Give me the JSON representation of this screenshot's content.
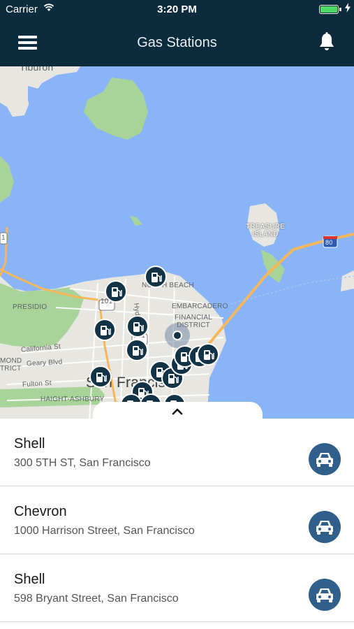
{
  "status_bar": {
    "carrier": "Carrier",
    "time": "3:20 PM",
    "battery_percent": 100,
    "icons": [
      "wifi-icon",
      "battery-icon",
      "charging-icon"
    ]
  },
  "header": {
    "title": "Gas Stations",
    "left_icon": "menu-icon",
    "right_icon": "bell-icon",
    "background_color": "#0c2b3d"
  },
  "map": {
    "labels": {
      "tiburon": "Tiburon",
      "treasure_island": "TREASURE\nISLAND",
      "north_beach": "NORTH BEACH",
      "embarcadero": "EMBARCADERO",
      "financial_district": "FINANCIAL\nDISTRICT",
      "presidio": "PRESIDIO",
      "hyde_st": "Hyde St",
      "california_st": "California St",
      "geary_blvd": "Geary Blvd",
      "richmond": "MOND\nTRICT",
      "fulton_st": "Fulton St",
      "haight_ashbury": "HAIGHT-ASHBURY",
      "city": "San Francisco",
      "shield_101_a": "101",
      "shield_101_b": "101",
      "shield_1": "1",
      "shield_80": "80"
    },
    "station_marker_icon": "gas-pump-icon",
    "current_location_icon": "location-dot-icon",
    "water_color": "#8ab4f8",
    "land_color": "#e8e6e1",
    "park_color": "#a8d49a"
  },
  "sheet": {
    "toggle_icon": "chevron-up-icon"
  },
  "stations": [
    {
      "name": "Shell",
      "address": "300 5TH ST, San Francisco",
      "action_icon": "car-icon"
    },
    {
      "name": "Chevron",
      "address": "1000 Harrison Street, San Francisco",
      "action_icon": "car-icon"
    },
    {
      "name": "Shell",
      "address": "598 Bryant Street, San Francisco",
      "action_icon": "car-icon"
    }
  ],
  "accent_color": "#2f5f8a"
}
